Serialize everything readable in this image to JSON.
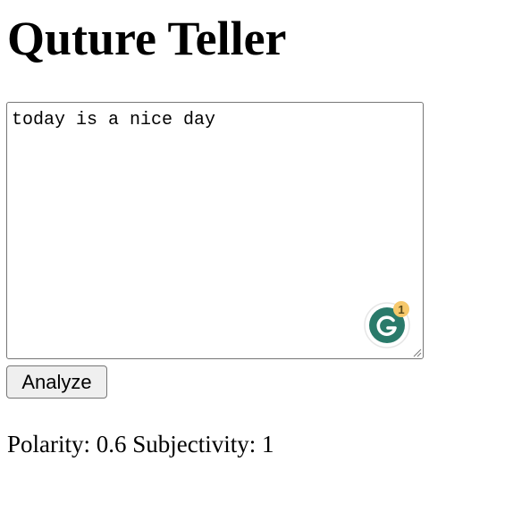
{
  "page": {
    "title": "Quture Teller"
  },
  "input": {
    "value": "today is a nice day",
    "placeholder": ""
  },
  "grammarly": {
    "icon": "grammarly-icon",
    "badge_count": "1",
    "brand_color": "#15c39a",
    "dark_color": "#2a7a6a",
    "badge_color": "#f6c86b"
  },
  "actions": {
    "analyze_label": "Analyze"
  },
  "result": {
    "polarity_label": "Polarity:",
    "polarity_value": "0.6",
    "subjectivity_label": "Subjectivity:",
    "subjectivity_value": "1"
  }
}
